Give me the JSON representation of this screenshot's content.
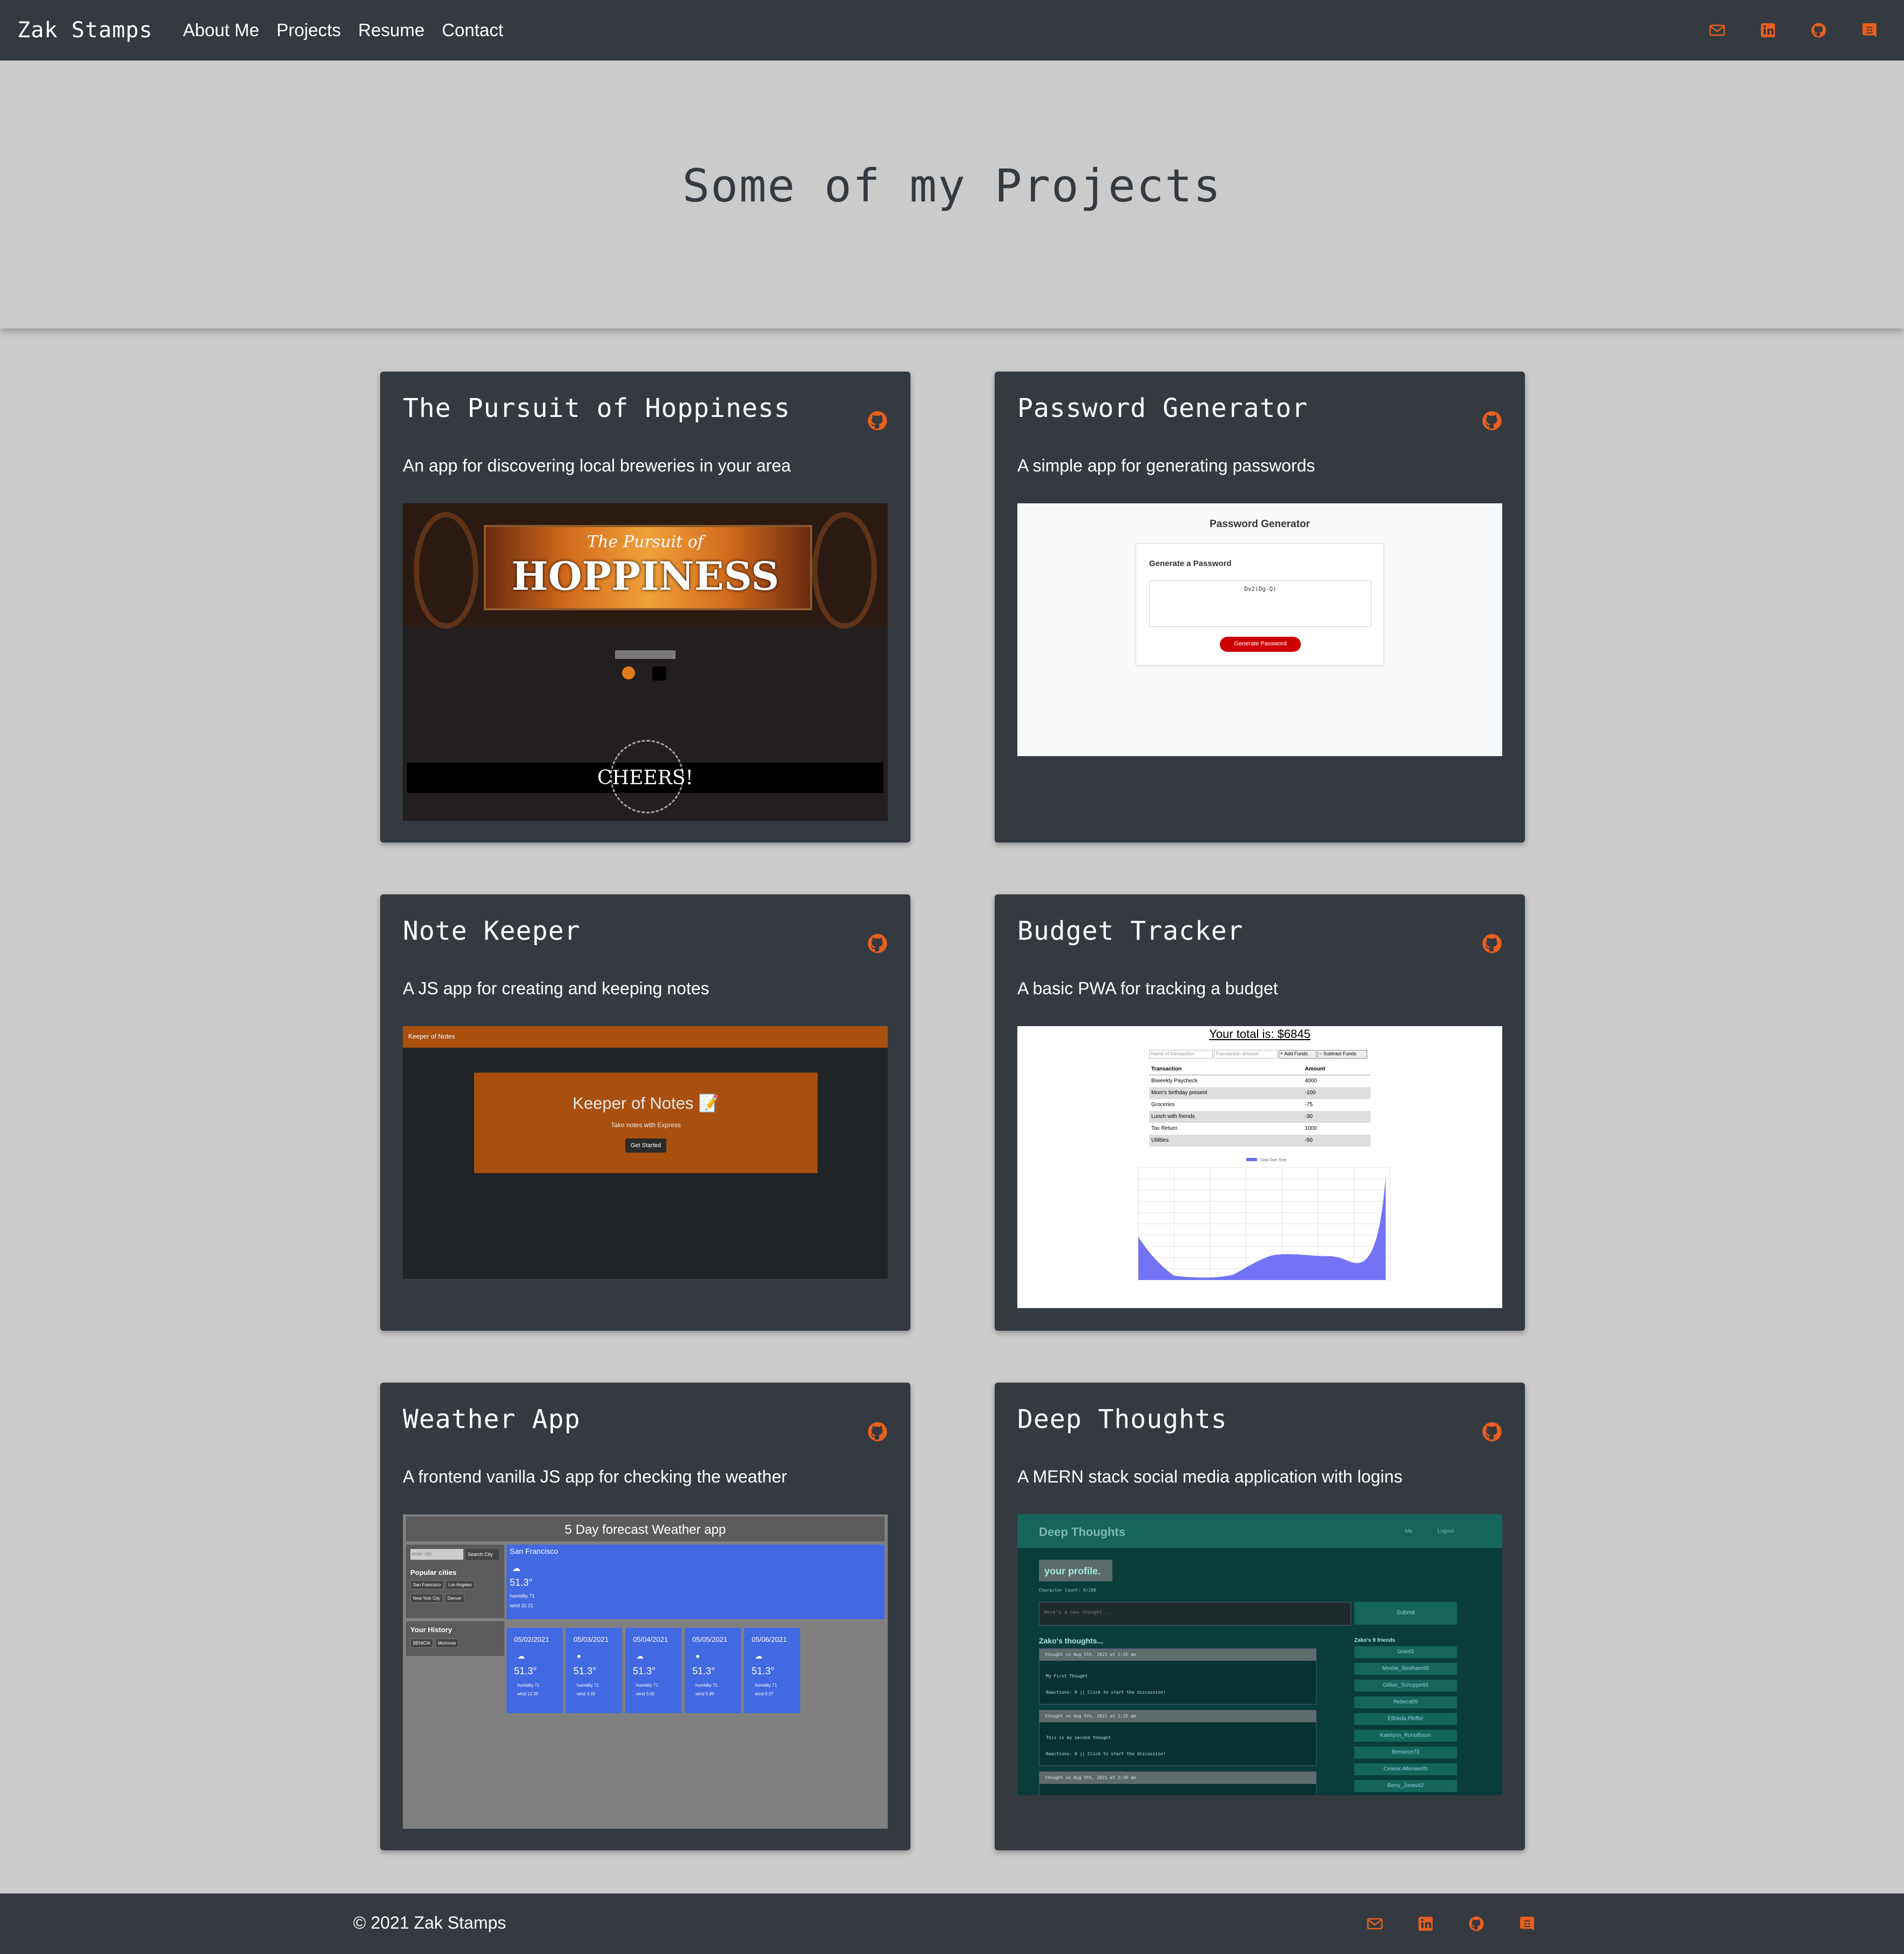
{
  "nav": {
    "brand": "Zak Stamps",
    "links": [
      "About Me",
      "Projects",
      "Resume",
      "Contact"
    ],
    "icons": [
      "envelope-icon",
      "linkedin-icon",
      "github-icon",
      "discord-icon"
    ],
    "icon_color": "#e95f1d"
  },
  "hero": {
    "title": "Some of my Projects"
  },
  "projects": [
    {
      "title": "The Pursuit of Hoppiness",
      "description": "An app for discovering local breweries in your area",
      "thumb": {
        "logo_line1": "The Pursuit of",
        "logo_line2": "HOPPINESS",
        "footer_text": "CHEERS!"
      }
    },
    {
      "title": "Password Generator",
      "description": "A simple app for generating passwords",
      "thumb": {
        "heading": "Password Generator",
        "card_title": "Generate a Password",
        "password": "Dv2(Dg-Q)",
        "button": "Generate Password"
      }
    },
    {
      "title": "Note Keeper",
      "description": "A JS app for creating and keeping notes",
      "thumb": {
        "bar": "Keeper of Notes",
        "heading": "Keeper of Notes 📝",
        "sub": "Take notes with Express",
        "button": "Get Started"
      }
    },
    {
      "title": "Budget Tracker",
      "description": "A basic PWA for tracking a budget",
      "thumb": {
        "total": "Your total is: $6845",
        "name_placeholder": "Name of transaction",
        "amount_placeholder": "Transaction amount",
        "add": "+ Add Funds",
        "subtract": "− Subtract Funds",
        "headers": [
          "Transaction",
          "Amount"
        ],
        "rows": [
          [
            "Biweekly Paycheck",
            "4000"
          ],
          [
            "Mom's birthday present",
            "-100"
          ],
          [
            "Groceries",
            "-75"
          ],
          [
            "Lunch with friends",
            "-30"
          ],
          [
            "Tax Return",
            "1000"
          ],
          [
            "Utilities",
            "-50"
          ]
        ],
        "legend": "Total Over Time"
      }
    },
    {
      "title": "Weather App",
      "description": "A frontend vanilla JS app for checking the weather",
      "thumb": {
        "header": "5 Day forecast Weather app",
        "search_placeholder": "enter city",
        "search_button": "Search City",
        "popular_label": "Popular cities",
        "cities": [
          "San Francisco",
          "Los Angeles",
          "New York City",
          "Denver"
        ],
        "history_label": "Your History",
        "history": [
          "BENICIA",
          "Monrovia"
        ],
        "current_city": "San Francisco",
        "current_temp": "51.3°",
        "current_humidity": "humidity 71",
        "current_wind": "wind 32.21",
        "days": [
          {
            "date": "05/02/2021",
            "temp": "51.3°",
            "humidity": "humidity 71",
            "wind": "wind 12.35"
          },
          {
            "date": "05/03/2021",
            "temp": "51.3°",
            "humidity": "humidity 71",
            "wind": "wind 3.33"
          },
          {
            "date": "05/04/2021",
            "temp": "51.3°",
            "humidity": "humidity 71",
            "wind": "wind 3.02"
          },
          {
            "date": "05/05/2021",
            "temp": "51.3°",
            "humidity": "humidity 71",
            "wind": "wind 5.99"
          },
          {
            "date": "05/06/2021",
            "temp": "51.3°",
            "humidity": "humidity 71",
            "wind": "wind 9.37"
          }
        ]
      }
    },
    {
      "title": "Deep Thoughts",
      "description": "A MERN stack social media application with logins",
      "thumb": {
        "app_title": "Deep Thoughts",
        "nav_me": "Me",
        "nav_logout": "Logout",
        "profile": "your profile.",
        "char_count": "Character Count: 0/280",
        "placeholder": "Here's a new thought...",
        "submit": "Submit",
        "thoughts_label": "Zako's thoughts...",
        "thoughts": [
          {
            "meta": "thought on Aug 5th, 2021 at 2:35 am",
            "body": "My First Thought",
            "reactions": "Reactions: 0 || Click to start the discussion!"
          },
          {
            "meta": "thought on Aug 5th, 2021 at 2:35 am",
            "body": "This is my second thought",
            "reactions": "Reactions: 0 || Click to start the discussion!"
          },
          {
            "meta": "thought on Aug 5th, 2021 at 2:38 am",
            "body": "",
            "reactions": ""
          }
        ],
        "friends_label": "Zako's 9 friends",
        "friends": [
          "Grant3",
          "Moshe_Smitham99",
          "Gillian_Schuppe89",
          "Rebeca55",
          "Elfrieda.Pfeffer",
          "Katelynn_Runolfsson",
          "Berniece73",
          "Ceasar.Altenwerth",
          "Berry_Jones42"
        ]
      }
    }
  ],
  "footer": {
    "copyright": "© 2021 Zak Stamps"
  }
}
